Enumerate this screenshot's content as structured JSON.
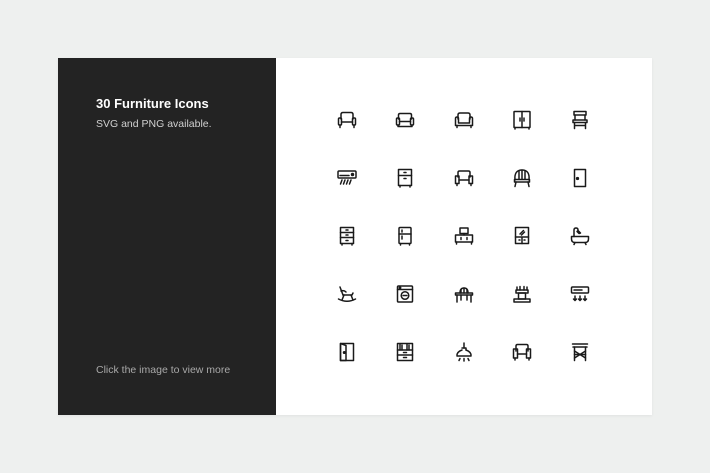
{
  "panel": {
    "title": "30 Furniture Icons",
    "subtitle": "SVG and PNG available.",
    "cta": "Click the image to view more"
  },
  "colors": {
    "page_background": "#eef0ef",
    "panel_dark": "#232323",
    "card_background": "#ffffff",
    "icon_stroke": "#1a1a1a"
  },
  "icons": [
    "armchair-icon",
    "sofa-icon",
    "couch-icon",
    "wardrobe-icon",
    "chair-icon",
    "air-conditioner-icon",
    "nightstand-icon",
    "loveseat-icon",
    "wicker-chair-icon",
    "door-icon",
    "drawer-cabinet-icon",
    "refrigerator-icon",
    "tv-stand-icon",
    "glass-cabinet-icon",
    "bathtub-icon",
    "rocking-chair-icon",
    "washing-machine-icon",
    "dining-table-icon",
    "fireplace-icon",
    "air-heater-icon",
    "open-door-icon",
    "bookshelf-icon",
    "ceiling-lamp-icon",
    "sofa-chair-icon",
    "side-table-icon"
  ]
}
